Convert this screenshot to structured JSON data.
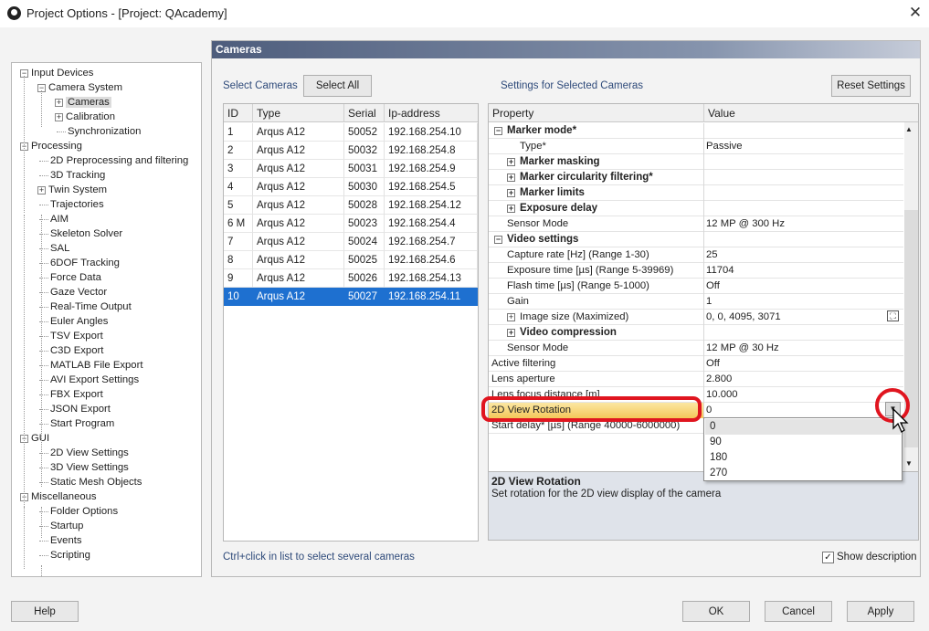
{
  "window": {
    "title": "Project Options - [Project: QAcademy]",
    "close_glyph": "✕"
  },
  "tree": {
    "items": [
      {
        "label": "Input Devices",
        "box": "⊟"
      },
      {
        "label": "Camera System",
        "box": "⊟"
      },
      {
        "label": "Cameras",
        "box": "⊞"
      },
      {
        "label": "Calibration",
        "box": "⊞"
      },
      {
        "label": "Synchronization"
      },
      {
        "label": "Processing",
        "box": "⊟"
      },
      {
        "label": "2D Preprocessing and filtering"
      },
      {
        "label": "3D Tracking"
      },
      {
        "label": "Twin System",
        "box": "⊞"
      },
      {
        "label": "Trajectories"
      },
      {
        "label": "AIM"
      },
      {
        "label": "Skeleton Solver"
      },
      {
        "label": "SAL"
      },
      {
        "label": "6DOF Tracking"
      },
      {
        "label": "Force Data"
      },
      {
        "label": "Gaze Vector"
      },
      {
        "label": "Real-Time Output"
      },
      {
        "label": "Euler Angles"
      },
      {
        "label": "TSV Export"
      },
      {
        "label": "C3D Export"
      },
      {
        "label": "MATLAB File Export"
      },
      {
        "label": "AVI Export Settings"
      },
      {
        "label": "FBX Export"
      },
      {
        "label": "JSON Export"
      },
      {
        "label": "Start Program"
      },
      {
        "label": "GUI",
        "box": "⊟"
      },
      {
        "label": "2D View Settings"
      },
      {
        "label": "3D View Settings"
      },
      {
        "label": "Static Mesh Objects"
      },
      {
        "label": "Miscellaneous",
        "box": "⊟"
      },
      {
        "label": "Folder Options"
      },
      {
        "label": "Startup"
      },
      {
        "label": "Events"
      },
      {
        "label": "Scripting"
      }
    ]
  },
  "panel": {
    "title": "Cameras",
    "select_cameras_label": "Select Cameras",
    "select_all": "Select All",
    "settings_label": "Settings for Selected Cameras",
    "reset_settings": "Reset Settings",
    "hint": "Ctrl+click in list to select several cameras",
    "show_description": "Show description",
    "check_glyph": "✓"
  },
  "cameras": {
    "columns": [
      "ID",
      "Type",
      "Serial",
      "Ip-address"
    ],
    "rows": [
      [
        "1",
        "Arqus A12",
        "50052",
        "192.168.254.10"
      ],
      [
        "2",
        "Arqus A12",
        "50032",
        "192.168.254.8"
      ],
      [
        "3",
        "Arqus A12",
        "50031",
        "192.168.254.9"
      ],
      [
        "4",
        "Arqus A12",
        "50030",
        "192.168.254.5"
      ],
      [
        "5",
        "Arqus A12",
        "50028",
        "192.168.254.12"
      ],
      [
        "6 M",
        "Arqus A12",
        "50023",
        "192.168.254.4"
      ],
      [
        "7",
        "Arqus A12",
        "50024",
        "192.168.254.7"
      ],
      [
        "8",
        "Arqus A12",
        "50025",
        "192.168.254.6"
      ],
      [
        "9",
        "Arqus A12",
        "50026",
        "192.168.254.13"
      ],
      [
        "10",
        "Arqus A12",
        "50027",
        "192.168.254.11"
      ]
    ],
    "selected_row": "10"
  },
  "settings": {
    "columns": [
      "Property",
      "Value"
    ],
    "rows": [
      {
        "name": "Marker mode*",
        "value": "",
        "cat": true,
        "box": "⊟"
      },
      {
        "name": "Type*",
        "value": "Passive"
      },
      {
        "name": "Marker masking",
        "value": "",
        "cat": true,
        "box": "⊞"
      },
      {
        "name": "Marker circularity filtering*",
        "value": "",
        "cat": true,
        "box": "⊞"
      },
      {
        "name": "Marker limits",
        "value": "",
        "cat": true,
        "box": "⊞"
      },
      {
        "name": "Exposure delay",
        "value": "",
        "cat": true,
        "box": "⊞"
      },
      {
        "name": "Sensor Mode",
        "value": "12 MP @ 300 Hz"
      },
      {
        "name": "Video settings",
        "value": "",
        "cat": true,
        "box": "⊟"
      },
      {
        "name": "Capture rate [Hz] (Range 1-30)",
        "value": "25"
      },
      {
        "name": "Exposure time [µs] (Range 5-39969)",
        "value": "11704"
      },
      {
        "name": "Flash time [µs] (Range 5-1000)",
        "value": "Off"
      },
      {
        "name": "Gain",
        "value": "1"
      },
      {
        "name": "Image size (Maximized)",
        "value": "0, 0, 4095, 3071",
        "box": "⊞"
      },
      {
        "name": "Video compression",
        "value": "",
        "cat": true,
        "box": "⊞"
      },
      {
        "name": "Sensor Mode",
        "value": "12 MP @ 30 Hz"
      },
      {
        "name": "Active filtering",
        "value": "Off"
      },
      {
        "name": "Lens aperture",
        "value": "2.800"
      },
      {
        "name": "Lens focus distance [m]",
        "value": "10.000"
      },
      {
        "name": "2D View Rotation",
        "value": "0",
        "sel": true
      },
      {
        "name": "Start delay* [µs] (Range 40000-6000000)",
        "value": ""
      }
    ],
    "dropdown_options": [
      "0",
      "90",
      "180",
      "270"
    ],
    "dropdown_selected": "0",
    "description_title": "2D View Rotation",
    "description_text": "Set rotation for the 2D view display of the camera"
  },
  "buttons": {
    "help": "Help",
    "ok": "OK",
    "cancel": "Cancel",
    "apply": "Apply"
  },
  "colors": {
    "highlight_ring": "#e0151f",
    "selection": "#1e70d0",
    "header_gradient_start": "#4e5d7c"
  }
}
